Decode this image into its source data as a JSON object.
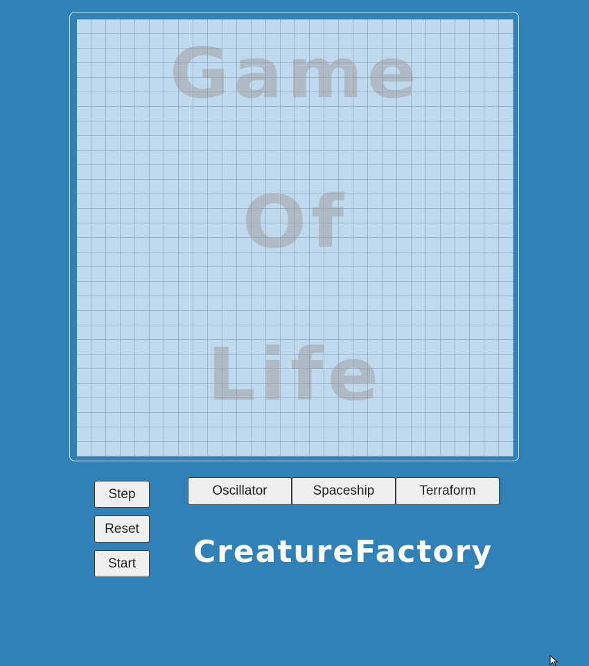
{
  "board": {
    "watermark_line1": "Game",
    "watermark_line2": "Of",
    "watermark_line3": "Life"
  },
  "controls": {
    "step_label": "Step",
    "reset_label": "Reset",
    "start_label": "Start"
  },
  "creatures": {
    "oscillator_label": "Oscillator",
    "spaceship_label": "Spaceship",
    "terraform_label": "Terraform"
  },
  "brand": {
    "title": "CreatureFactory"
  },
  "colors": {
    "page_background": "#3181b9",
    "board_background": "#c1d9ed",
    "button_background": "#efefef",
    "title_text": "#ffffff"
  },
  "icons": {
    "cursor": "mouse-pointer-icon"
  }
}
